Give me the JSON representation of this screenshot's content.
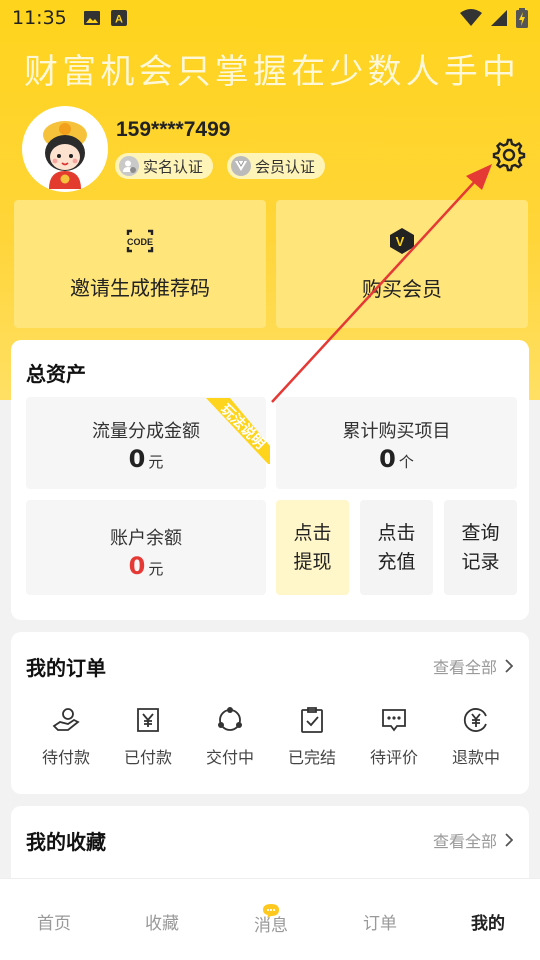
{
  "status_bar": {
    "time": "11:35"
  },
  "slogan": [
    "财",
    "富",
    "机",
    "会",
    "只",
    "掌",
    "握",
    "在",
    "少",
    "数",
    "人",
    "手",
    "中"
  ],
  "profile": {
    "phone": "159****7499",
    "badge_realname": "实名认证",
    "badge_member": "会员认证"
  },
  "tiles": {
    "invite": {
      "icon_text": "CODE",
      "label": "邀请生成推荐码"
    },
    "buy_vip": {
      "icon_text": "V",
      "label": "购买会员"
    }
  },
  "assets": {
    "title": "总资产",
    "ribbon": "玩法说明",
    "traffic_share": {
      "label": "流量分成金额",
      "value": "0",
      "unit": "元"
    },
    "purchased": {
      "label": "累计购买项目",
      "value": "0",
      "unit": "个"
    },
    "balance": {
      "label": "账户余额",
      "value": "0",
      "unit": "元"
    },
    "withdraw": "点击\n提现",
    "withdraw_l1": "点击",
    "withdraw_l2": "提现",
    "recharge_l1": "点击",
    "recharge_l2": "充值",
    "records_l1": "查询",
    "records_l2": "记录"
  },
  "orders": {
    "title": "我的订单",
    "view_all": "查看全部",
    "items": [
      {
        "label": "待付款",
        "icon": "hand-money-icon"
      },
      {
        "label": "已付款",
        "icon": "yen-receipt-icon"
      },
      {
        "label": "交付中",
        "icon": "delivery-cycle-icon"
      },
      {
        "label": "已完结",
        "icon": "clipboard-check-icon"
      },
      {
        "label": "待评价",
        "icon": "comment-icon"
      },
      {
        "label": "退款中",
        "icon": "refund-icon"
      }
    ]
  },
  "favorites": {
    "title": "我的收藏",
    "view_all": "查看全部"
  },
  "tabbar": {
    "items": [
      {
        "label": "首页"
      },
      {
        "label": "收藏"
      },
      {
        "label": "消息"
      },
      {
        "label": "订单"
      },
      {
        "label": "我的"
      }
    ],
    "active": "我的"
  },
  "colors": {
    "brand_yellow": "#ffd41c",
    "accent_red": "#e53935",
    "tile_yellow": "#ffe57a"
  }
}
